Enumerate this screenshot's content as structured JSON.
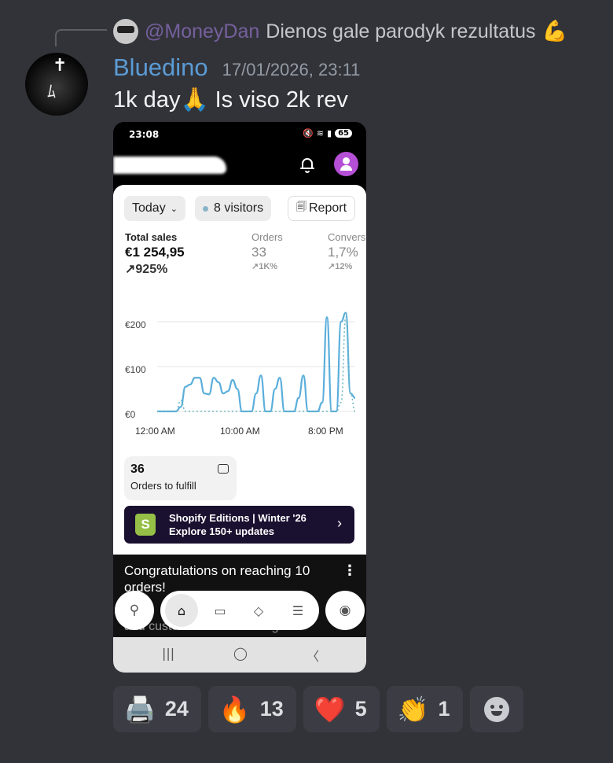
{
  "reply": {
    "username": "@MoneyDan",
    "text": "Dienos gale parodyk rezultatus",
    "emoji": "💪"
  },
  "message": {
    "username": "Bluedino",
    "timestamp": "17/01/2026, 23:11",
    "text_before": "1k day",
    "emoji": "🙏",
    "text_after": " Is viso 2k rev"
  },
  "phone": {
    "status_time": "23:08",
    "battery": "65",
    "filters": {
      "period": "Today",
      "visitors": "8 visitors",
      "report": "Report"
    },
    "metrics": {
      "total_sales_label": "Total sales",
      "total_sales_value": "€1 254,95",
      "total_sales_delta": "↗925%",
      "orders_label": "Orders",
      "orders_value": "33",
      "orders_delta": "↗1K%",
      "conversion_label": "Convers",
      "conversion_value": "1,7%",
      "conversion_delta": "↗12%"
    },
    "orders_to_fulfill": {
      "count": "36",
      "label": "Orders to fulfill"
    },
    "promo": {
      "line1": "Shopify Editions | Winter '26",
      "line2": "Explore 150+ updates"
    },
    "congrats": "Congratulations on reaching 10 orders!",
    "faded_text": "and customers are catching on."
  },
  "chart_data": {
    "type": "line",
    "y_ticks": [
      "€200",
      "€100",
      "€0"
    ],
    "x_ticks": [
      "12:00 AM",
      "10:00 AM",
      "8:00 PM"
    ],
    "ylim": [
      0,
      230
    ],
    "series": [
      {
        "values": [
          0,
          0,
          0,
          0,
          0,
          10,
          55,
          60,
          75,
          75,
          40,
          38,
          75,
          65,
          40,
          45,
          70,
          50,
          0,
          0,
          0,
          40,
          80,
          0,
          0,
          50,
          75,
          0,
          0,
          0,
          30,
          80,
          0,
          0,
          0,
          20,
          210,
          0,
          0,
          200,
          220,
          40,
          30
        ]
      },
      {
        "values": [
          0,
          0,
          0,
          0,
          0,
          25,
          0,
          0,
          0,
          0,
          0,
          0,
          0,
          0,
          0,
          0,
          0,
          0,
          0,
          0,
          0,
          0,
          0,
          0,
          0,
          0,
          0,
          0,
          0,
          0,
          0,
          0,
          0,
          0,
          0,
          0,
          0,
          0,
          0,
          20,
          210,
          40,
          0
        ]
      }
    ],
    "colors": [
      "#5aaedb",
      "#6fb9c4"
    ]
  },
  "reactions": [
    {
      "emoji": "🖨️",
      "count": "24"
    },
    {
      "emoji": "🔥",
      "count": "13"
    },
    {
      "emoji": "❤️",
      "count": "5"
    },
    {
      "emoji": "👏",
      "count": "1"
    }
  ]
}
